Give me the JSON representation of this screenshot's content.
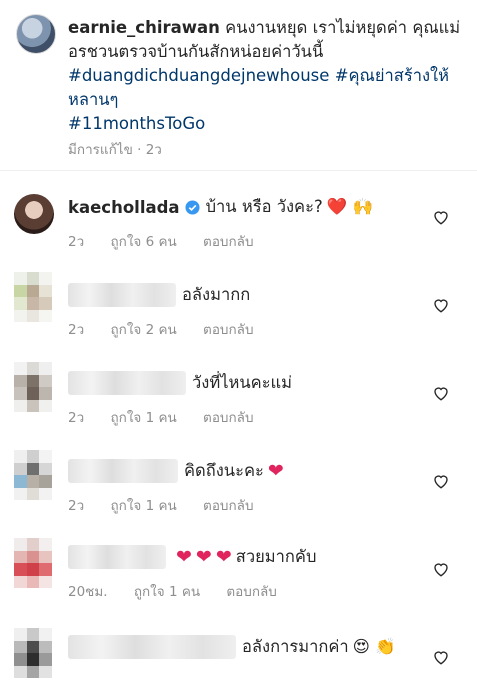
{
  "caption": {
    "username": "earnie_chirawan",
    "text": "คนงานหยุด เราไม่หยุดค่า คุณแม่อรชวนตรวจบ้านกันสักหน่อยค่าวันนี้",
    "hashtag1": "#duangdichduangdejnewhouse",
    "hashtag2": "#คุณย่าสร้างให้หลานๆ",
    "hashtag3": "#11monthsToGo",
    "edited": "มีการแก้ไข",
    "time": "2ว"
  },
  "comments": [
    {
      "username": "kaechollada",
      "text": "บ้าน หรือ วังคะ?",
      "emojis": "❤️ 🙌",
      "time": "2ว",
      "likes": "ถูกใจ 6 คน",
      "reply": "ตอบกลับ"
    },
    {
      "username": "",
      "text": "อลังมากก",
      "time": "2ว",
      "likes": "ถูกใจ 2 คน",
      "reply": "ตอบกลับ"
    },
    {
      "username": "",
      "text": "วังที่ไหนคะแม่",
      "time": "2ว",
      "likes": "ถูกใจ 1 คน",
      "reply": "ตอบกลับ"
    },
    {
      "username": "",
      "text": "คิดถึงนะคะ",
      "time": "2ว",
      "likes": "ถูกใจ 1 คน",
      "reply": "ตอบกลับ"
    },
    {
      "username": "",
      "text": "สวยมากคับ",
      "time": "20ชม.",
      "likes": "ถูกใจ 1 คน",
      "reply": "ตอบกลับ"
    },
    {
      "username": "",
      "text": "อลังการมากค่า",
      "time": "",
      "likes": "",
      "reply": ""
    }
  ],
  "colors": {
    "heart": "#e0245e",
    "link": "#00376b",
    "meta": "#8e8e8e",
    "verified": "#3897f0"
  },
  "icons": {
    "like": "heart-outline-icon",
    "verified": "verified-badge-icon"
  }
}
